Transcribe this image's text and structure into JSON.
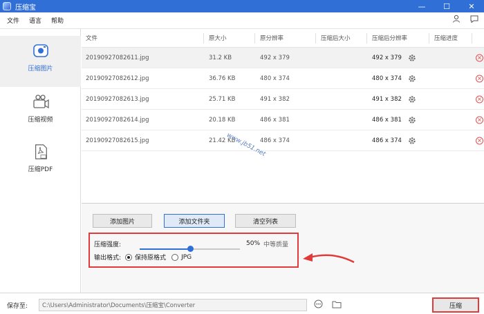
{
  "window": {
    "title": "压缩宝",
    "minimize": "—",
    "maximize": "☐",
    "close": "✕"
  },
  "menu": {
    "items": [
      "文件",
      "语言",
      "帮助"
    ]
  },
  "sidebar": {
    "items": [
      {
        "label": "压缩图片",
        "icon": "image-icon",
        "active": true
      },
      {
        "label": "压缩视频",
        "icon": "video-icon",
        "active": false
      },
      {
        "label": "压缩PDF",
        "icon": "pdf-icon",
        "active": false
      }
    ]
  },
  "table": {
    "headers": [
      "文件",
      "原大小",
      "原分辨率",
      "压缩后大小",
      "压缩后分辨率",
      "压缩进度"
    ],
    "rows": [
      {
        "file": "20190927082611.jpg",
        "size": "31.2 KB",
        "res": "492 x 379",
        "csize": "",
        "cres": "492 x 379"
      },
      {
        "file": "20190927082612.jpg",
        "size": "36.76 KB",
        "res": "480 x 374",
        "csize": "",
        "cres": "480 x 374"
      },
      {
        "file": "20190927082613.jpg",
        "size": "25.71 KB",
        "res": "491 x 382",
        "csize": "",
        "cres": "491 x 382"
      },
      {
        "file": "20190927082614.jpg",
        "size": "20.18 KB",
        "res": "486 x 381",
        "csize": "",
        "cres": "486 x 381"
      },
      {
        "file": "20190927082615.jpg",
        "size": "21.42 KB",
        "res": "486 x 374",
        "csize": "",
        "cres": "486 x 374"
      }
    ]
  },
  "watermark": "www.jb51.net",
  "actions": {
    "add_image": "添加图片",
    "add_folder": "添加文件夹",
    "clear_list": "清空列表"
  },
  "settings": {
    "strength_label": "压缩强度:",
    "strength_value": 50,
    "strength_text": "50%",
    "quality_text": "中等质量",
    "format_label": "输出格式:",
    "format_options": [
      "保持原格式",
      "JPG"
    ],
    "format_selected": "保持原格式"
  },
  "footer": {
    "save_label": "保存至:",
    "save_path": "C:\\Users\\Administrator\\Documents\\压缩宝\\Converter",
    "compress_label": "压缩"
  },
  "colors": {
    "accent": "#2f6fd6",
    "highlight": "#e03a3a"
  }
}
